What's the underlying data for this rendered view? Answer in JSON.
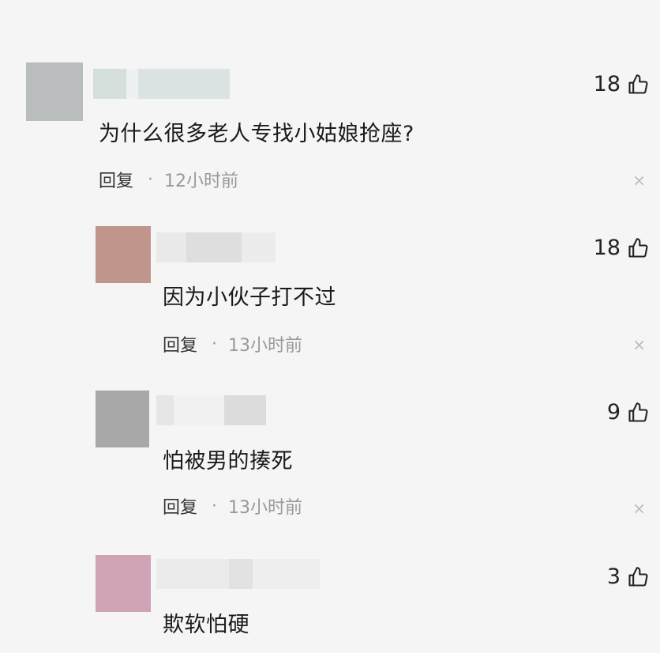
{
  "comments": [
    {
      "avatar_color": "#b9bdbd",
      "name_blur_colors": [
        "#d5dfdc",
        "#eef1f1",
        "#dbe4e2"
      ],
      "content": "为什么很多老人专找小姑娘抢座?",
      "reply_label": "回复",
      "separator": "·",
      "time": "12小时前",
      "likes": "18",
      "like_icon": "thumbs-up-icon",
      "close_icon": "close-icon",
      "close_glyph": "×"
    },
    {
      "avatar_color": "#c0958c",
      "name_blur_colors": [
        "#e9e9e9",
        "#dedede",
        "#ececec"
      ],
      "content": "因为小伙子打不过",
      "reply_label": "回复",
      "separator": "·",
      "time": "13小时前",
      "likes": "18",
      "like_icon": "thumbs-up-icon",
      "close_icon": "close-icon",
      "close_glyph": "×"
    },
    {
      "avatar_color": "#a8a8a8",
      "name_blur_colors": [
        "#e6e6e6",
        "#f1f1f1",
        "#dcdcdc"
      ],
      "content": "怕被男的揍死",
      "reply_label": "回复",
      "separator": "·",
      "time": "13小时前",
      "likes": "9",
      "like_icon": "thumbs-up-icon",
      "close_icon": "close-icon",
      "close_glyph": "×"
    },
    {
      "avatar_color": "#cfa4b6",
      "name_blur_colors": [
        "#ebebeb",
        "#e2e2e2",
        "#eeeeee"
      ],
      "content": "欺软怕硬",
      "likes": "3",
      "like_icon": "thumbs-up-icon"
    }
  ]
}
